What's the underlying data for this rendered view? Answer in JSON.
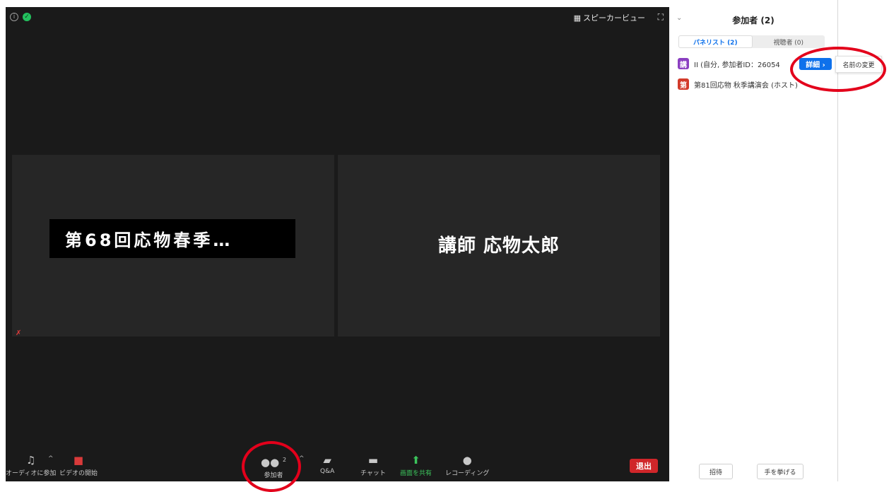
{
  "video": {
    "speaker_view_label": "スピーカービュー",
    "left_tile_name": "第68回応物春季…",
    "right_tile_name": "講師 応物太郎"
  },
  "controls": {
    "audio_label": "オーディオに参加",
    "video_label": "ビデオの開始",
    "participants_label": "参加者",
    "participants_count": "2",
    "qa_label": "Q&A",
    "chat_label": "チャット",
    "share_label": "画面を共有",
    "record_label": "レコーディング",
    "leave_label": "退出"
  },
  "panel": {
    "title": "参加者 (2)",
    "tabs": [
      {
        "label": "パネリスト (2)"
      },
      {
        "label": "視聴者 (0)"
      }
    ],
    "participants": [
      {
        "avatar": "講",
        "name": "II (自分, 参加者ID：26054",
        "color": "#8b3fc1"
      },
      {
        "avatar": "第",
        "name": "第81回応物 秋季講演会 (ホスト)",
        "color": "#d23a2a"
      }
    ],
    "details_label": "詳細 ›",
    "rename_label": "名前の変更",
    "invite_label": "招待",
    "raise_hand_label": "手を挙げる"
  },
  "colors": {
    "meeting_bg": "#1a1a1a",
    "tile_bg": "#262626",
    "accent_blue": "#0e71eb",
    "leave_red": "#d0262a",
    "annotation_red": "#e3001b"
  }
}
